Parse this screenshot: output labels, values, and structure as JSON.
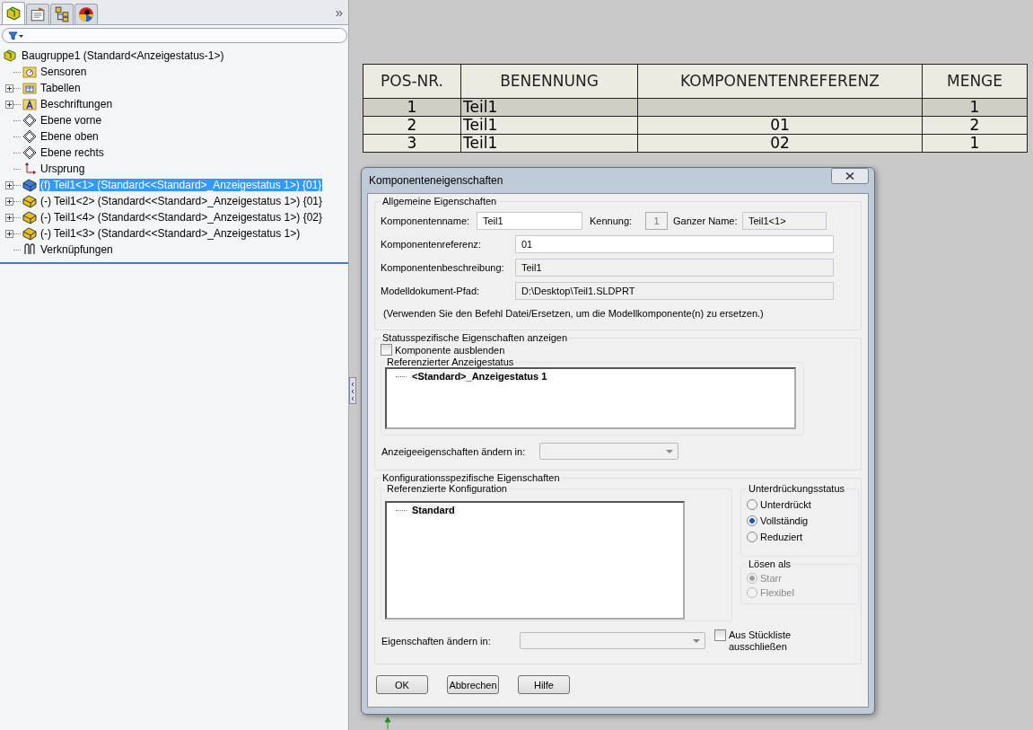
{
  "panel_tabs": [
    {
      "kind": "assembly",
      "selected": true
    },
    {
      "kind": "properties",
      "selected": false
    },
    {
      "kind": "configurations",
      "selected": false
    },
    {
      "kind": "appearance",
      "selected": false
    }
  ],
  "panel_more": "»",
  "tree": {
    "label": "Baugruppe1  (Standard<Anzeigestatus-1>)",
    "kind": "assembly",
    "selected": false,
    "children": [
      {
        "label": "Sensoren",
        "kind": "sensors",
        "selected": false
      },
      {
        "label": "Tabellen",
        "kind": "tables",
        "selected": false,
        "expanded": false
      },
      {
        "label": "Beschriftungen",
        "kind": "annotations",
        "selected": false,
        "expanded": false
      },
      {
        "label": "Ebene vorne",
        "kind": "plane",
        "selected": false
      },
      {
        "label": "Ebene oben",
        "kind": "plane",
        "selected": false
      },
      {
        "label": "Ebene rechts",
        "kind": "plane",
        "selected": false
      },
      {
        "label": "Ursprung",
        "kind": "origin",
        "selected": false
      },
      {
        "label": "(f) Teil1<1> (Standard<<Standard>_Anzeigestatus 1>) {01}",
        "kind": "part",
        "selected": true,
        "expanded": false
      },
      {
        "label": "(-) Teil1<2> (Standard<<Standard>_Anzeigestatus 1>) {01}",
        "kind": "part",
        "selected": false,
        "expanded": false
      },
      {
        "label": "(-) Teil1<4> (Standard<<Standard>_Anzeigestatus 1>) {02}",
        "kind": "part",
        "selected": false,
        "expanded": false
      },
      {
        "label": "(-) Teil1<3> (Standard<<Standard>_Anzeigestatus 1>)",
        "kind": "part",
        "selected": false,
        "expanded": false
      },
      {
        "label": "Verknüpfungen",
        "kind": "mates",
        "selected": false
      }
    ]
  },
  "bom_table": {
    "columns": [
      "POS-NR.",
      "BENENNUNG",
      "KOMPONENTENREFERENZ",
      "MENGE"
    ],
    "rows": [
      {
        "cells": [
          "1",
          "Teil1",
          "",
          "1"
        ],
        "selected": true
      },
      {
        "cells": [
          "2",
          "Teil1",
          "01",
          "2"
        ],
        "selected": false
      },
      {
        "cells": [
          "3",
          "Teil1",
          "02",
          "1"
        ],
        "selected": false
      }
    ]
  },
  "dialog": {
    "title": "Komponenteneigenschaften",
    "general": {
      "title": "Allgemeine Eigenschaften",
      "name_label": "Komponentenname:",
      "name_value": "Teil1",
      "id_label": "Kennung:",
      "id_value": "1",
      "fullname_label": "Ganzer Name:",
      "fullname_value": "Teil1<1>",
      "reference_label": "Komponentenreferenz:",
      "reference_value": "01",
      "description_label": "Komponentenbeschreibung:",
      "description_value": "Teil1",
      "path_label": "Modelldokument-Pfad:",
      "path_value": "D:\\Desktop\\Teil1.SLDPRT",
      "hint": "(Verwenden Sie den Befehl Datei/Ersetzen, um die Modellkomponente(n) zu ersetzen.)"
    },
    "display": {
      "title": "Statusspezifische Eigenschaften anzeigen",
      "hide": {
        "label": "Komponente ausblenden",
        "checked": false
      },
      "list_title": "Referenzierter Anzeigestatus",
      "list_items": [
        "<Standard>_Anzeigestatus 1"
      ],
      "change_label": "Anzeigeeigenschaften ändern in:"
    },
    "config": {
      "title": "Konfigurationsspezifische Eigenschaften",
      "list_title": "Referenzierte Konfiguration",
      "list_items": [
        "Standard"
      ],
      "suppression": {
        "title": "Unterdrückungsstatus",
        "disabled": false,
        "options": [
          {
            "label": "Unterdrückt",
            "selected": false
          },
          {
            "label": "Vollständig",
            "selected": true
          },
          {
            "label": "Reduziert",
            "selected": false
          }
        ]
      },
      "solve": {
        "title": "Lösen als",
        "disabled": true,
        "options": [
          {
            "label": "Starr",
            "selected": true
          },
          {
            "label": "Flexibel",
            "selected": false
          }
        ]
      },
      "change_label": "Eigenschaften ändern in:",
      "exclude": {
        "label": "Aus Stückliste ausschließen",
        "checked": false
      }
    },
    "buttons": [
      "OK",
      "Abbrechen",
      "Hilfe"
    ]
  }
}
